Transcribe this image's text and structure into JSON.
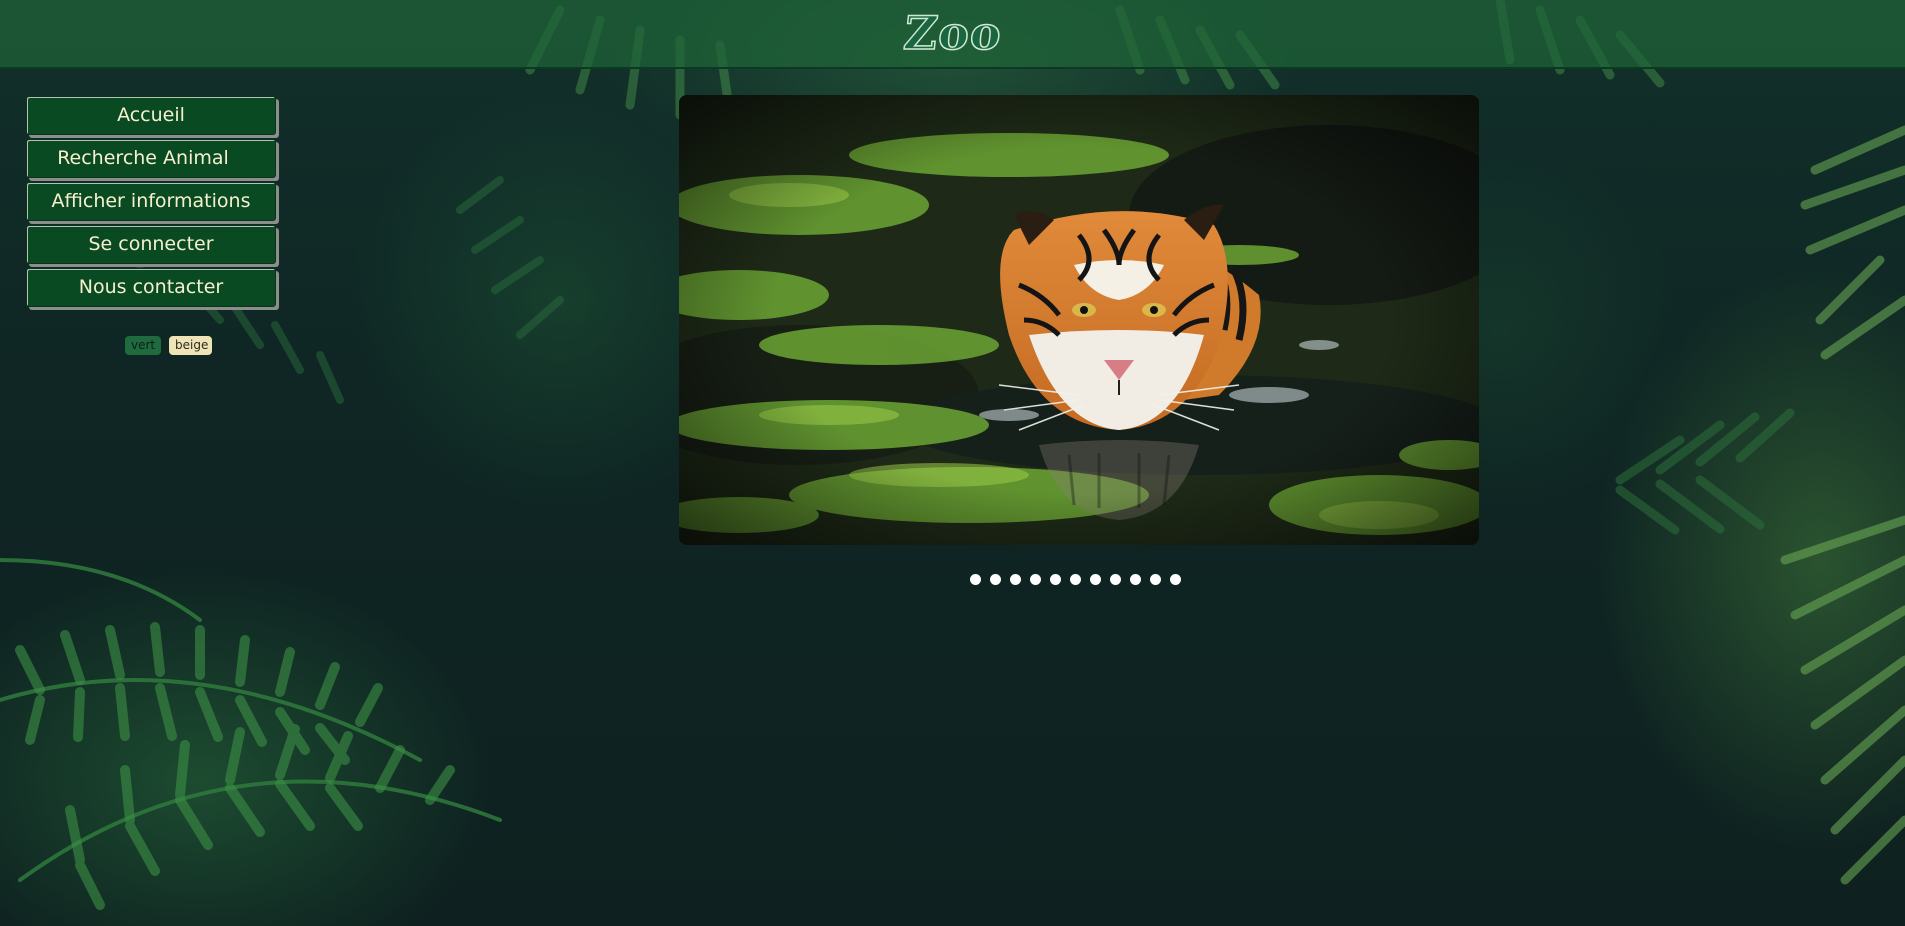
{
  "header": {
    "title": "Zoo"
  },
  "nav": {
    "items": [
      {
        "label": "Accueil"
      },
      {
        "label": "Recherche Animal"
      },
      {
        "label": "Afficher informations"
      },
      {
        "label": "Se connecter"
      },
      {
        "label": "Nous contacter"
      }
    ]
  },
  "theme": {
    "green_label": "vert",
    "beige_label": "beige"
  },
  "carousel": {
    "image": "tiger-swimming-photo",
    "slide_count": 11,
    "active_slide": 1
  },
  "colors": {
    "header_bg": "#1e6437",
    "nav_bg": "#0a4a22",
    "nav_text": "#f6f0cf",
    "page_bg": "#0f2322"
  }
}
